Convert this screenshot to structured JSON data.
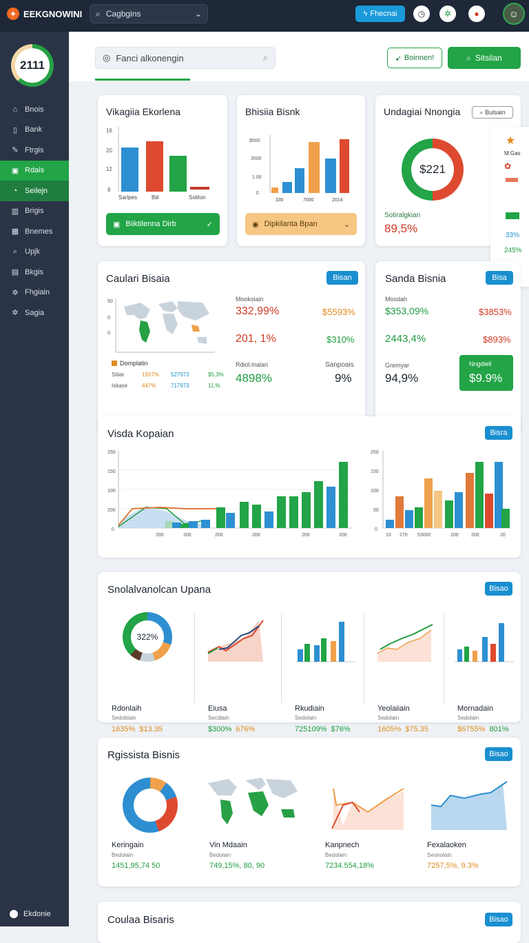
{
  "topbar": {
    "brand": "EEKGNOWINI",
    "search_value": "Cagbgins",
    "button_label": "Fhecnai",
    "colors": {
      "bg": "#1e2838",
      "accent": "#1a9ad9"
    }
  },
  "sidebar": {
    "score": "2111",
    "items": [
      {
        "label": "Bnois",
        "icon": "home-icon"
      },
      {
        "label": "Bank",
        "icon": "bank-icon"
      },
      {
        "label": "Ftrgis",
        "icon": "edit-icon"
      },
      {
        "label": "Rdais",
        "icon": "briefcase-icon",
        "state": "active"
      },
      {
        "label": "Seilejn",
        "icon": "clock-icon",
        "state": "sub"
      },
      {
        "label": "Brigis",
        "icon": "building-icon"
      },
      {
        "label": "Bnemes",
        "icon": "grid-icon"
      },
      {
        "label": "Upjk",
        "icon": "search-icon"
      },
      {
        "label": "Bkgis",
        "icon": "document-icon"
      },
      {
        "label": "Fhgiain",
        "icon": "gear-icon"
      },
      {
        "label": "Sagia",
        "icon": "gear-icon"
      }
    ],
    "footer": "Ekdonie"
  },
  "toolbar": {
    "search_value": "Fanci alkonengin",
    "outline_button": "Boinnen!",
    "primary_button": "Sitsilan"
  },
  "card1": {
    "title": "Vikagiia Ekorlena",
    "yticks": [
      "16",
      "20",
      "12",
      "9"
    ],
    "xlabels": [
      "Sarlpes",
      "Biil",
      "Sotilon"
    ],
    "button": "Biiktilenna Dirb"
  },
  "card2": {
    "title": "Bhisiia Bisnk",
    "yticks": [
      "$500",
      "3500",
      "1 00",
      "0"
    ],
    "xlabels": [
      "330",
      "7000",
      "2014"
    ],
    "button": "Dipkilanta Bpan"
  },
  "card3": {
    "title": "Undagiai Nnongia",
    "pill": "Bulsain",
    "donut_value": "$221",
    "sub_label": "Sotiralgkian",
    "percent": "89,5%",
    "donut_share": 0.5
  },
  "peek": {
    "label": "M:Gas",
    "v1": "33%",
    "v2": "245%"
  },
  "card4": {
    "title": "Caulari Bisaia",
    "badge": "Bisan",
    "header": "Mooksiain",
    "vals": [
      {
        "left": "332,99%",
        "right": "$5593%"
      },
      {
        "left": "201, 1%",
        "right": "$310%"
      }
    ],
    "footer_left_label": "Rdiol.inalan",
    "footer_left_value": "4898%",
    "footer_right_label": "Sanpoais",
    "footer_right_value": "9%",
    "legend_title": "Domplatin",
    "legend_rows": [
      {
        "name": "Sitiar",
        "a": "1937%",
        "b": "527973",
        "c": "$5,3%"
      },
      {
        "name": "Iskase",
        "a": "447%",
        "b": "717973",
        "c": "11,%"
      }
    ]
  },
  "card5": {
    "title": "Sanda Bisnia",
    "badge": "Bisa",
    "header": "Mosdah",
    "vals": [
      {
        "left": "$353,09%",
        "right": "$3853%"
      },
      {
        "left": "2443,4%",
        "right": "$893%"
      }
    ],
    "footer_left_label": "Gremyar",
    "footer_left_value": "94,9%",
    "box_label": "Nngdiell",
    "box_value": "$9.9%"
  },
  "card6": {
    "title": "Visda Kopaian",
    "badge": "Bisra",
    "left_chart": {
      "yticks": [
        "250",
        "150",
        "100",
        "200",
        "0"
      ],
      "xticks": [
        "200",
        "200",
        "200",
        "200",
        "200",
        "200"
      ]
    },
    "right_chart": {
      "yticks": [
        "250",
        "150",
        "100",
        "50",
        "0"
      ],
      "xticks": [
        "10",
        "270",
        "53000",
        "200",
        "200",
        "20"
      ]
    }
  },
  "card7": {
    "title": "Snolalvanolcan Upana",
    "badge": "Bisao",
    "donut_value": "322%",
    "minis": [
      {
        "name": "Rdonlaih",
        "sub": "Sedoblain",
        "v1": "1635%",
        "v2": "$13.35"
      },
      {
        "name": "Eiusa",
        "sub": "Secdlain",
        "v1": "$300%",
        "v2": "676%"
      },
      {
        "name": "Rkudiain",
        "sub": "Sedolain",
        "v1": "725109%",
        "v2": "$76%"
      },
      {
        "name": "Yeolaiiain",
        "sub": "Sedolain",
        "v1": "1605%",
        "v2": "$75.35"
      },
      {
        "name": "Mornadain",
        "sub": "Sedolain",
        "v1": "$6755%",
        "v2": "801%"
      }
    ]
  },
  "card8": {
    "title": "Rgissista Bisnis",
    "badge": "Bisao",
    "minis": [
      {
        "name": "Keringain",
        "sub": "Bedolain",
        "value": "1451,95,74 50"
      },
      {
        "name": "Vin Mdaain",
        "sub": "Bedolain",
        "value": "749,15%, 80, 90"
      },
      {
        "name": "Kanpnech",
        "sub": "Bedolain",
        "value": "7234.554,18%"
      },
      {
        "name": "Fexalaoken",
        "sub": "Seonolain",
        "value": "7257,5%, 9.3%"
      }
    ]
  },
  "card9": {
    "title": "Coulaa Bisaris",
    "badge": "Bisao"
  }
}
